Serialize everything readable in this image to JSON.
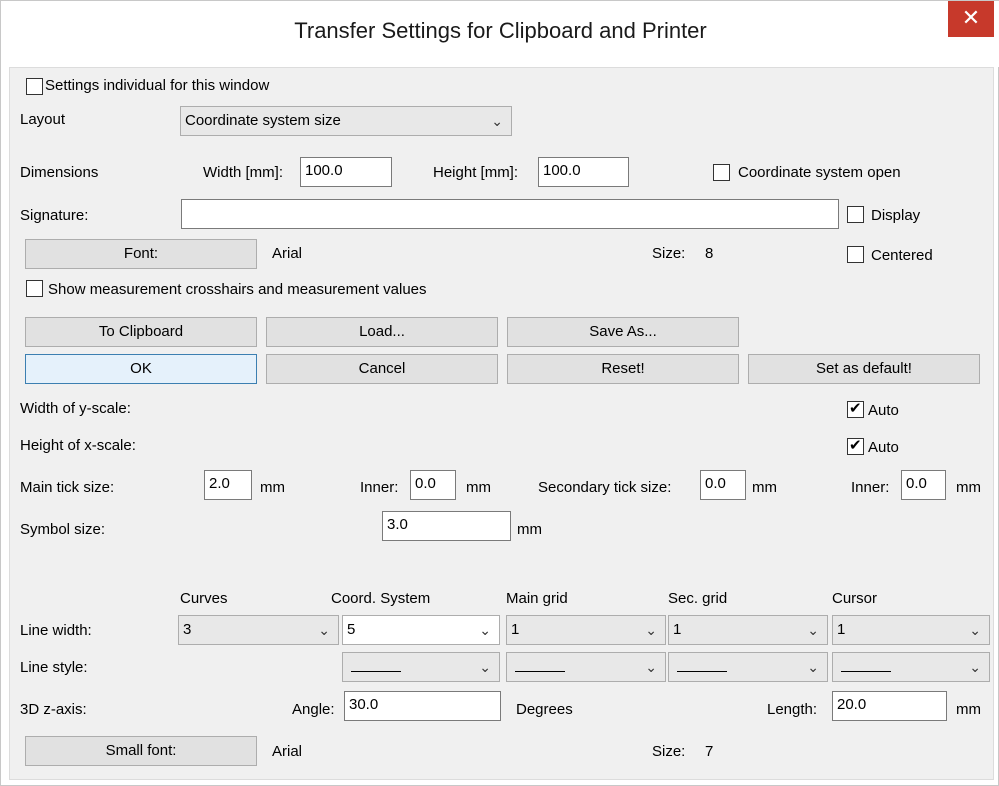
{
  "window": {
    "title": "Transfer Settings for Clipboard and Printer",
    "close_glyph": "✕"
  },
  "settings_individual": {
    "label": "Settings individual for this window",
    "checked": false
  },
  "layout": {
    "label": "Layout",
    "value": "Coordinate system size"
  },
  "dimensions": {
    "label": "Dimensions",
    "width_label": "Width [mm]:",
    "width_value": "100.0",
    "height_label": "Height [mm]:",
    "height_value": "100.0",
    "coord_open_label": "Coordinate system open",
    "coord_open_checked": false
  },
  "signature": {
    "label": "Signature:",
    "value": "",
    "display_label": "Display",
    "display_checked": false,
    "centered_label": "Centered",
    "centered_checked": false
  },
  "font": {
    "button_label": "Font:",
    "name": "Arial",
    "size_label": "Size:",
    "size_value": "8"
  },
  "crosshairs": {
    "label": "Show measurement crosshairs and measurement values",
    "checked": false
  },
  "buttons": {
    "to_clipboard": "To Clipboard",
    "load": "Load...",
    "save_as": "Save As...",
    "ok": "OK",
    "cancel": "Cancel",
    "reset": "Reset!",
    "set_default": "Set as default!"
  },
  "scales": {
    "y_width_label": "Width of y-scale:",
    "y_auto_label": "Auto",
    "y_auto_checked": true,
    "x_height_label": "Height of x-scale:",
    "x_auto_label": "Auto",
    "x_auto_checked": true
  },
  "ticks": {
    "main_label": "Main tick size:",
    "main_value": "2.0",
    "main_unit": "mm",
    "inner_label": "Inner:",
    "inner_value": "0.0",
    "inner_unit": "mm",
    "secondary_label": "Secondary tick size:",
    "secondary_value": "0.0",
    "secondary_unit": "mm",
    "inner2_label": "Inner:",
    "inner2_value": "0.0",
    "inner2_unit": "mm"
  },
  "symbol": {
    "label": "Symbol size:",
    "value": "3.0",
    "unit": "mm"
  },
  "columns": {
    "curves": "Curves",
    "coord_system": "Coord. System",
    "main_grid": "Main grid",
    "sec_grid": "Sec. grid",
    "cursor": "Cursor"
  },
  "line_width": {
    "label": "Line width:",
    "curves": "3",
    "coord_system": "5",
    "main_grid": "1",
    "sec_grid": "1",
    "cursor": "1"
  },
  "line_style": {
    "label": "Line style:"
  },
  "z_axis": {
    "label": "3D z-axis:",
    "angle_label": "Angle:",
    "angle_value": "30.0",
    "angle_unit": "Degrees",
    "length_label": "Length:",
    "length_value": "20.0",
    "length_unit": "mm"
  },
  "small_font": {
    "button_label": "Small font:",
    "name": "Arial",
    "size_label": "Size:",
    "size_value": "7"
  },
  "icons": {
    "chevron": "chevron-down-icon",
    "check": "check-icon",
    "close": "close-icon"
  }
}
